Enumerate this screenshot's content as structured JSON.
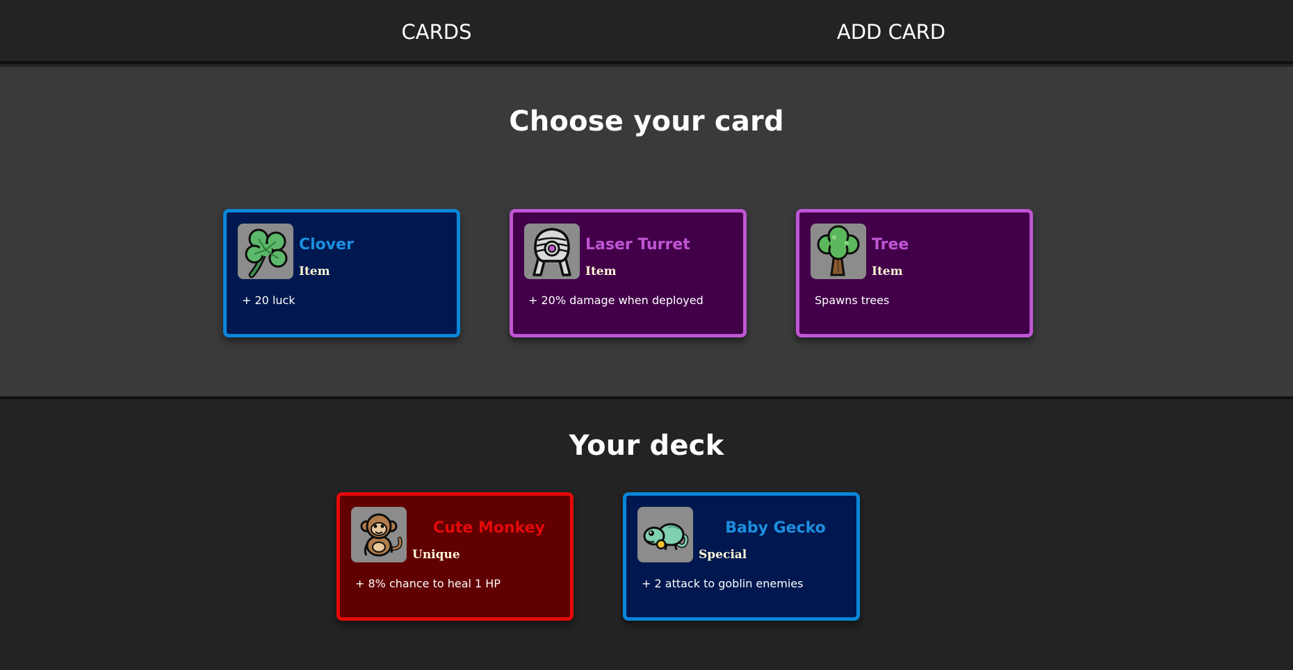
{
  "nav": {
    "cards_label": "CARDS",
    "add_card_label": "ADD CARD"
  },
  "choose": {
    "title": "Choose your card",
    "cards": [
      {
        "name": "Clover",
        "type": "Item",
        "description": "+ 20 luck",
        "rarity_color": "#1c8fe0",
        "icon": "clover-icon"
      },
      {
        "name": "Laser Turret",
        "type": "Item",
        "description": "+ 20% damage when deployed",
        "rarity_color": "#bf56d4",
        "icon": "laser-turret-icon"
      },
      {
        "name": "Tree",
        "type": "Item",
        "description": "Spawns trees",
        "rarity_color": "#bf56d4",
        "icon": "tree-icon"
      }
    ]
  },
  "deck": {
    "title": "Your deck",
    "cards": [
      {
        "name": "Cute Monkey",
        "type": "Unique",
        "description": "+ 8% chance to heal 1 HP",
        "rarity_color": "#e30a0a",
        "icon": "monkey-icon"
      },
      {
        "name": "Baby Gecko",
        "type": "Special",
        "description": "+ 2 attack to goblin enemies",
        "rarity_color": "#1c8fe0",
        "icon": "gecko-icon"
      }
    ]
  },
  "colors": {
    "background": "#232323",
    "choose_background": "#3a3a3a",
    "blue_card": "#00184f",
    "purple_card": "#420049",
    "red_card": "#610000"
  }
}
